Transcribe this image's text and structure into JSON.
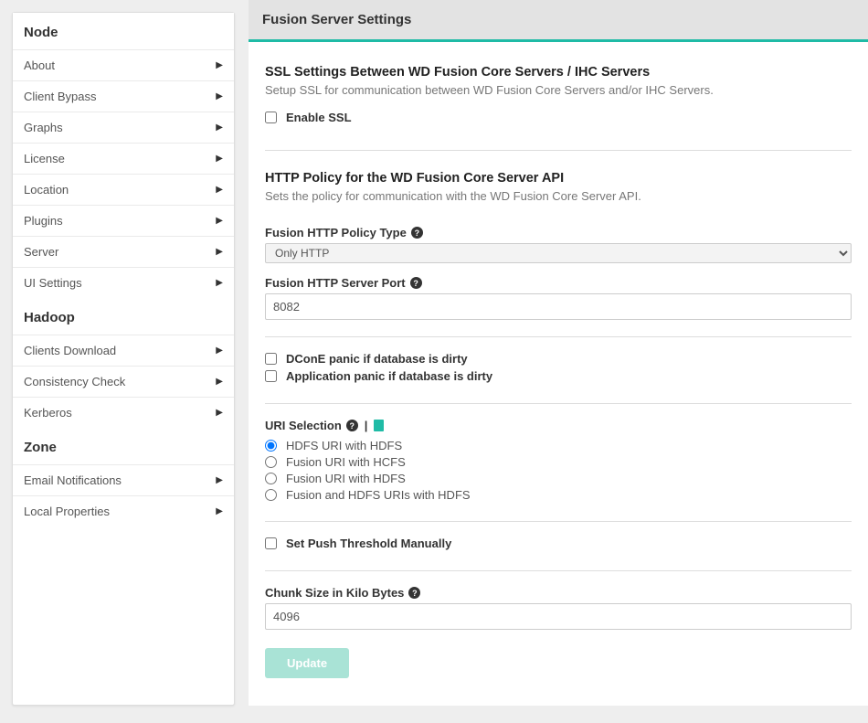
{
  "sidebar": {
    "sections": [
      {
        "title": "Node",
        "items": [
          {
            "label": "About"
          },
          {
            "label": "Client Bypass"
          },
          {
            "label": "Graphs"
          },
          {
            "label": "License"
          },
          {
            "label": "Location"
          },
          {
            "label": "Plugins"
          },
          {
            "label": "Server"
          },
          {
            "label": "UI Settings"
          }
        ]
      },
      {
        "title": "Hadoop",
        "items": [
          {
            "label": "Clients Download"
          },
          {
            "label": "Consistency Check"
          },
          {
            "label": "Kerberos"
          }
        ]
      },
      {
        "title": "Zone",
        "items": [
          {
            "label": "Email Notifications"
          },
          {
            "label": "Local Properties"
          }
        ]
      }
    ]
  },
  "main": {
    "header": "Fusion Server Settings",
    "ssl": {
      "title": "SSL Settings Between WD Fusion Core Servers / IHC Servers",
      "desc": "Setup SSL for communication between WD Fusion Core Servers and/or IHC Servers.",
      "enable_label": "Enable SSL"
    },
    "http": {
      "title": "HTTP Policy for the WD Fusion Core Server API",
      "desc": "Sets the policy for communication with the WD Fusion Core Server API.",
      "policy_type_label": "Fusion HTTP Policy Type",
      "policy_type_value": "Only HTTP",
      "server_port_label": "Fusion HTTP Server Port",
      "server_port_value": "8082",
      "dcone_panic_label": "DConE panic if database is dirty",
      "app_panic_label": "Application panic if database is dirty",
      "uri_selection_label": "URI Selection",
      "uri_options": [
        "HDFS URI with HDFS",
        "Fusion URI with HCFS",
        "Fusion URI with HDFS",
        "Fusion and HDFS URIs with HDFS"
      ],
      "push_threshold_label": "Set Push Threshold Manually",
      "chunk_size_label": "Chunk Size in Kilo Bytes",
      "chunk_size_value": "4096"
    },
    "update_label": "Update"
  }
}
